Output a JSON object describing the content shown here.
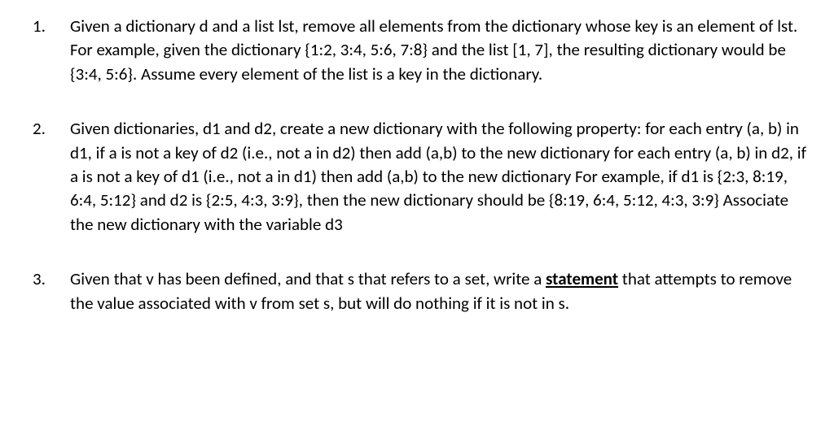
{
  "questions": [
    {
      "segments": [
        {
          "text": "Given a dictionary d and a list lst, remove all elements from the dictionary whose key is an element of lst. For example, given the dictionary {1:2, 3:4, 5:6, 7:8} and the list [1, 7], the resulting dictionary would be {3:4, 5:6}. Assume every element of the list is a key in the dictionary."
        }
      ]
    },
    {
      "segments": [
        {
          "text": "Given dictionaries, d1 and d2, create a new dictionary with the following property: for each entry (a, b) in d1, if a is not a key of d2 (i.e., not a in d2) then add (a,b) to the new dictionary for each entry (a, b) in d2, if a is not a key of d1 (i.e., not a in d1) then add (a,b) to the new dictionary For example, if d1 is {2:3, 8:19, 6:4, 5:12} and d2 is {2:5, 4:3, 3:9}, then the new dictionary should be {8:19, 6:4, 5:12, 4:3, 3:9} Associate the new dictionary with the variable d3"
        }
      ]
    },
    {
      "segments": [
        {
          "text": "Given that v has been defined, and that s that refers to a set, write a "
        },
        {
          "text": "statement",
          "style": "underline-bold"
        },
        {
          "text": " that attempts to remove the value associated with v from set s, but will do nothing if it is not in s."
        }
      ]
    }
  ]
}
